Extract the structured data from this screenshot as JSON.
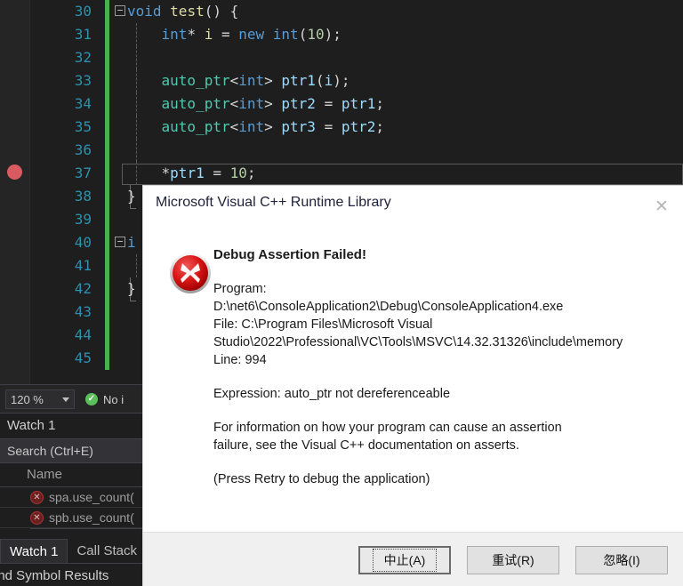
{
  "editor": {
    "lines": [
      {
        "num": "30",
        "fold": "−",
        "indent": 0,
        "tokens": [
          {
            "t": "void ",
            "c": "kw"
          },
          {
            "t": "test",
            "c": "fn"
          },
          {
            "t": "() {",
            "c": "punc"
          }
        ]
      },
      {
        "num": "31",
        "indent": 1,
        "guide": true,
        "tokens": [
          {
            "t": "    ",
            "c": "punc"
          },
          {
            "t": "int",
            "c": "kw"
          },
          {
            "t": "* ",
            "c": "punc"
          },
          {
            "t": "i",
            "c": "fn"
          },
          {
            "t": " = ",
            "c": "punc"
          },
          {
            "t": "new ",
            "c": "kw"
          },
          {
            "t": "int",
            "c": "kw"
          },
          {
            "t": "(",
            "c": "punc"
          },
          {
            "t": "10",
            "c": "num"
          },
          {
            "t": ");",
            "c": "punc"
          }
        ]
      },
      {
        "num": "32",
        "indent": 1,
        "guide": true,
        "tokens": []
      },
      {
        "num": "33",
        "indent": 1,
        "guide": true,
        "tokens": [
          {
            "t": "    ",
            "c": "punc"
          },
          {
            "t": "auto_ptr",
            "c": "type"
          },
          {
            "t": "<",
            "c": "punc"
          },
          {
            "t": "int",
            "c": "kw"
          },
          {
            "t": "> ",
            "c": "punc"
          },
          {
            "t": "ptr1",
            "c": "var"
          },
          {
            "t": "(",
            "c": "punc"
          },
          {
            "t": "i",
            "c": "var"
          },
          {
            "t": ");",
            "c": "punc"
          }
        ]
      },
      {
        "num": "34",
        "indent": 1,
        "guide": true,
        "tokens": [
          {
            "t": "    ",
            "c": "punc"
          },
          {
            "t": "auto_ptr",
            "c": "type"
          },
          {
            "t": "<",
            "c": "punc"
          },
          {
            "t": "int",
            "c": "kw"
          },
          {
            "t": "> ",
            "c": "punc"
          },
          {
            "t": "ptr2",
            "c": "var"
          },
          {
            "t": " = ",
            "c": "punc"
          },
          {
            "t": "ptr1",
            "c": "var"
          },
          {
            "t": ";",
            "c": "punc"
          }
        ]
      },
      {
        "num": "35",
        "indent": 1,
        "guide": true,
        "tokens": [
          {
            "t": "    ",
            "c": "punc"
          },
          {
            "t": "auto_ptr",
            "c": "type"
          },
          {
            "t": "<",
            "c": "punc"
          },
          {
            "t": "int",
            "c": "kw"
          },
          {
            "t": "> ",
            "c": "punc"
          },
          {
            "t": "ptr3",
            "c": "var"
          },
          {
            "t": " = ",
            "c": "punc"
          },
          {
            "t": "ptr2",
            "c": "var"
          },
          {
            "t": ";",
            "c": "punc"
          }
        ]
      },
      {
        "num": "36",
        "indent": 1,
        "guide": true,
        "tokens": []
      },
      {
        "num": "37",
        "indent": 1,
        "guide": true,
        "current": true,
        "tokens": [
          {
            "t": "    ",
            "c": "punc"
          },
          {
            "t": "*",
            "c": "punc"
          },
          {
            "t": "ptr1",
            "c": "var"
          },
          {
            "t": " = ",
            "c": "punc"
          },
          {
            "t": "10",
            "c": "num"
          },
          {
            "t": ";",
            "c": "punc"
          }
        ]
      },
      {
        "num": "38",
        "indent": 0,
        "braceEnd": true,
        "tokens": [
          {
            "t": "}",
            "c": "punc"
          }
        ]
      },
      {
        "num": "39",
        "indent": 0,
        "tokens": []
      },
      {
        "num": "40",
        "fold": "−",
        "indent": 0,
        "tokens": [
          {
            "t": "i",
            "c": "kw"
          }
        ]
      },
      {
        "num": "41",
        "indent": 1,
        "guide": true,
        "tokens": []
      },
      {
        "num": "42",
        "indent": 0,
        "braceEnd": true,
        "tokens": [
          {
            "t": "}",
            "c": "punc"
          }
        ]
      },
      {
        "num": "43",
        "indent": 0,
        "tokens": []
      },
      {
        "num": "44",
        "indent": 1,
        "tokens": [
          {
            "t": "  /",
            "c": "cmt"
          }
        ]
      },
      {
        "num": "45",
        "indent": 0,
        "tokens": []
      }
    ],
    "breakpoint_line": "37"
  },
  "status_bar": {
    "zoom_level": "120 %",
    "issues_text": "No i",
    "issues_icon": "check-circle-icon",
    "dropdown_icon": "chevron-down-icon"
  },
  "watch_panel": {
    "title": "Watch 1",
    "search_placeholder": "Search (Ctrl+E)",
    "column_name": "Name",
    "rows": [
      {
        "icon": "error-icon",
        "name": "spa.use_count("
      },
      {
        "icon": "error-icon",
        "name": "spb.use_count("
      }
    ],
    "tabs": [
      {
        "label": "Watch 1",
        "active": true
      },
      {
        "label": "Call Stack",
        "active": false
      }
    ],
    "bottom_tab": "ind Symbol Results"
  },
  "dialog": {
    "title": "Microsoft Visual C++ Runtime Library",
    "close_icon": "close-icon",
    "error_icon": "error-circle-icon",
    "heading": "Debug Assertion Failed!",
    "program_label": "Program:",
    "program_path": "D:\\net6\\ConsoleApplication2\\Debug\\ConsoleApplication4.exe",
    "file_line_1": "File: C:\\Program Files\\Microsoft Visual",
    "file_line_2": "Studio\\2022\\Professional\\VC\\Tools\\MSVC\\14.32.31326\\include\\memory",
    "line_label": "Line: 994",
    "expression": "Expression: auto_ptr not dereferenceable",
    "info_line_1": "For information on how your program can cause an assertion",
    "info_line_2": "failure, see the Visual C++ documentation on asserts.",
    "retry_hint": "(Press Retry to debug the application)",
    "buttons": [
      {
        "label": "中止(A)",
        "default": true
      },
      {
        "label": "重试(R)",
        "default": false
      },
      {
        "label": "忽略(I)",
        "default": false
      }
    ]
  },
  "colors": {
    "editor_bg": "#1e1e1e",
    "accent_green": "#4caf50",
    "linenum": "#2b91af",
    "error_red": "#cc0000",
    "dialog_bg": "#ffffff"
  }
}
